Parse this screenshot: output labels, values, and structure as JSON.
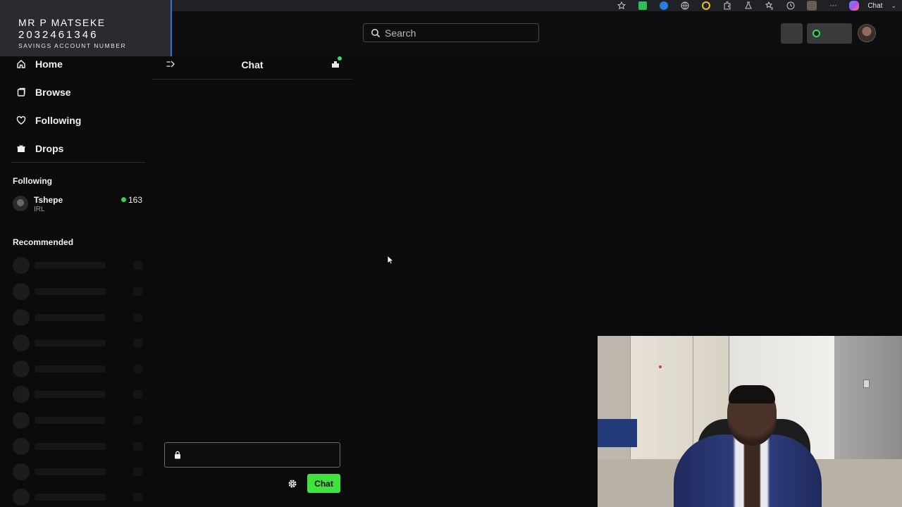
{
  "browser": {
    "chat_label": "Chat"
  },
  "account_banner": {
    "name": "MR P MATSEKE",
    "number": "2032461346",
    "type": "SAVINGS ACCOUNT NUMBER"
  },
  "search": {
    "placeholder": "Search"
  },
  "sidebar": {
    "nav": [
      {
        "label": "Home",
        "icon": "home-icon"
      },
      {
        "label": "Browse",
        "icon": "browse-icon"
      },
      {
        "label": "Following",
        "icon": "heart-icon"
      },
      {
        "label": "Drops",
        "icon": "gift-icon"
      }
    ],
    "following_title": "Following",
    "following": [
      {
        "name": "Tshepe",
        "category": "IRL",
        "viewers": "163"
      }
    ],
    "recommended_title": "Recommended"
  },
  "chat": {
    "title": "Chat",
    "input_placeholder": "",
    "send_label": "Chat"
  },
  "colors": {
    "accent_green": "#3fe23f",
    "live_green": "#34d058",
    "background": "#0b0b0c",
    "banner_border": "#3b6de0"
  }
}
